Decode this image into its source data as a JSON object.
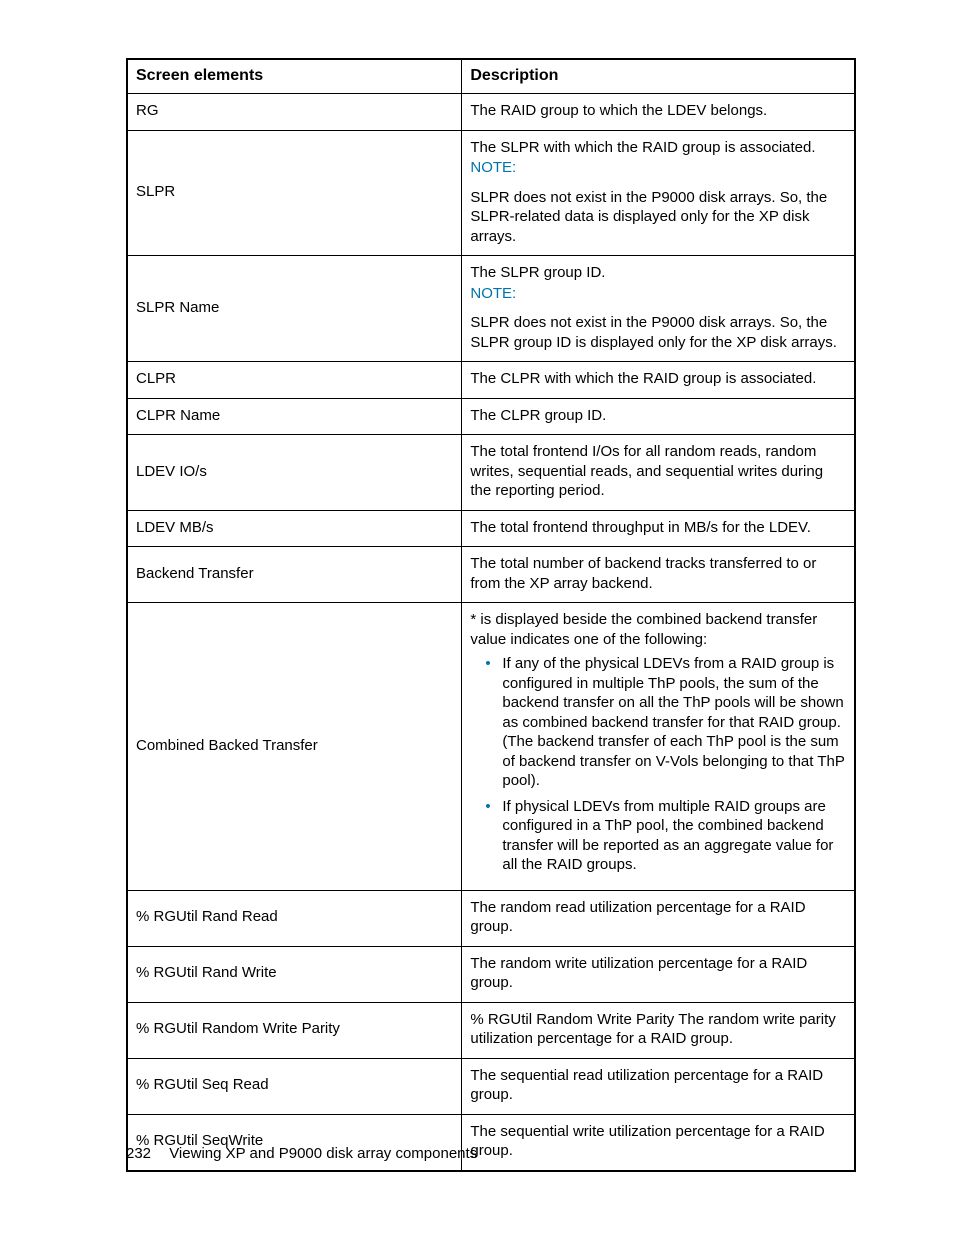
{
  "table": {
    "header": [
      "Screen elements",
      "Description"
    ]
  },
  "rows": {
    "rg": {
      "el": "RG",
      "desc": "The RAID group to which the LDEV belongs."
    },
    "slpr": {
      "el": "SLPR",
      "d1": "The SLPR with which the RAID group is associated.",
      "note": "NOTE:",
      "d2": "SLPR does not exist in the P9000 disk arrays. So, the SLPR-related data is displayed only for the XP disk arrays."
    },
    "slprname": {
      "el": "SLPR Name",
      "d1": "The SLPR group ID.",
      "note": "NOTE:",
      "d2": "SLPR does not exist in the P9000 disk arrays. So, the SLPR group ID is displayed only for the XP disk arrays."
    },
    "clpr": {
      "el": "CLPR",
      "desc": "The CLPR with which the RAID group is associated."
    },
    "clprname": {
      "el": "CLPR Name",
      "desc": "The CLPR group ID."
    },
    "ldevio": {
      "el": "LDEV IO/s",
      "desc": "The total frontend I/Os for all random reads, random writes, sequential reads, and sequential writes during the reporting period."
    },
    "ldevmb": {
      "el": "LDEV MB/s",
      "desc": "The total frontend throughput in MB/s for the LDEV."
    },
    "backend": {
      "el": "Backend Transfer",
      "desc": "The total number of backend tracks transferred to or from the XP array backend."
    },
    "combined": {
      "el": "Combined Backed Transfer",
      "intro": "* is displayed beside the combined backend transfer value indicates one of the following:",
      "b1": "If any of the physical LDEVs from a RAID group is configured in multiple ThP pools, the sum of the backend transfer on all the ThP pools will be shown as combined backend transfer for that RAID group. (The backend transfer of each ThP pool is the sum of backend transfer on V-Vols belonging to that ThP pool).",
      "b2": "If physical LDEVs from multiple RAID groups are configured in a ThP pool, the combined backend transfer will be reported as an aggregate value for all the RAID groups."
    },
    "rr": {
      "el": "% RGUtil Rand Read",
      "desc": "The random read utilization percentage for a RAID group."
    },
    "rw": {
      "el": "% RGUtil Rand Write",
      "desc": "The random write utilization percentage for a RAID group."
    },
    "rwp": {
      "el": "% RGUtil Random Write Parity",
      "desc": "% RGUtil Random Write Parity The random write parity utilization percentage for a RAID group."
    },
    "sr": {
      "el": "% RGUtil Seq Read",
      "desc": "The sequential read utilization percentage for a RAID group."
    },
    "sw": {
      "el": "% RGUtil SeqWrite",
      "desc": "The sequential write utilization percentage for a RAID group."
    }
  },
  "footer": {
    "page": "232",
    "title": "Viewing XP and P9000 disk array components"
  }
}
